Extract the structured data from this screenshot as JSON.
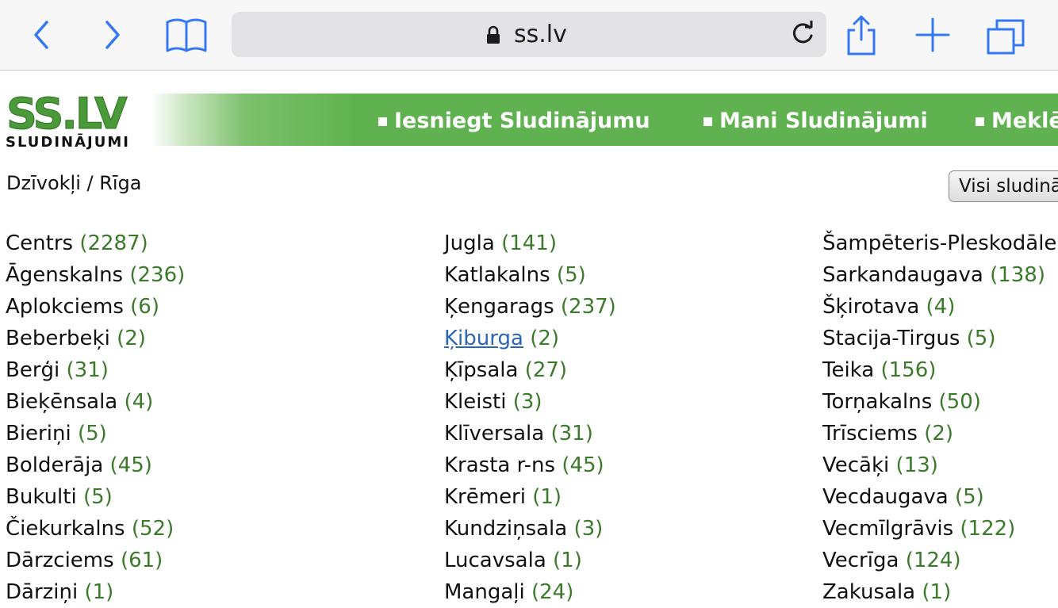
{
  "browser": {
    "url": "ss.lv",
    "colors": {
      "accent": "#3478f6"
    }
  },
  "header": {
    "logo": "SS.LV",
    "logo_sub": "SLUDINĀJUMI",
    "links": [
      "Iesniegt Sludinājumu",
      "Mani Sludinājumi",
      "Meklē"
    ]
  },
  "breadcrumb": "Dzīvokļi / Rīga",
  "visi_button": "Visi sludinā",
  "columns": [
    [
      {
        "name": "Centrs",
        "count": "(2287)"
      },
      {
        "name": "Āgenskalns",
        "count": "(236)"
      },
      {
        "name": "Aplokciems",
        "count": "(6)"
      },
      {
        "name": "Beberbeķi",
        "count": "(2)"
      },
      {
        "name": "Berģi",
        "count": "(31)"
      },
      {
        "name": "Bieķēnsala",
        "count": "(4)"
      },
      {
        "name": "Bieriņi",
        "count": "(5)"
      },
      {
        "name": "Bolderāja",
        "count": "(45)"
      },
      {
        "name": "Bukulti",
        "count": "(5)"
      },
      {
        "name": "Čiekurkalns",
        "count": "(52)"
      },
      {
        "name": "Dārzciems",
        "count": "(61)"
      },
      {
        "name": "Dārziņi",
        "count": "(1)"
      }
    ],
    [
      {
        "name": "Jugla",
        "count": "(141)"
      },
      {
        "name": "Katlakalns",
        "count": "(5)"
      },
      {
        "name": "Ķengarags",
        "count": "(237)"
      },
      {
        "name": "Ķiburga",
        "count": "(2)",
        "link": true
      },
      {
        "name": "Ķīpsala",
        "count": "(27)"
      },
      {
        "name": "Kleisti",
        "count": "(3)"
      },
      {
        "name": "Klīversala",
        "count": "(31)"
      },
      {
        "name": "Krasta r-ns",
        "count": "(45)"
      },
      {
        "name": "Krēmeri",
        "count": "(1)"
      },
      {
        "name": "Kundziņsala",
        "count": "(3)"
      },
      {
        "name": "Lucavsala",
        "count": "(1)"
      },
      {
        "name": "Mangaļi",
        "count": "(24)"
      }
    ],
    [
      {
        "name": "Šampēteris-Pleskodāle",
        "count": ""
      },
      {
        "name": "Sarkandaugava",
        "count": "(138)"
      },
      {
        "name": "Šķirotava",
        "count": "(4)"
      },
      {
        "name": "Stacija-Tirgus",
        "count": "(5)"
      },
      {
        "name": "Teika",
        "count": "(156)"
      },
      {
        "name": "Torņakalns",
        "count": "(50)"
      },
      {
        "name": "Trīsciems",
        "count": "(2)"
      },
      {
        "name": "Vecāķi",
        "count": "(13)"
      },
      {
        "name": "Vecdaugava",
        "count": "(5)"
      },
      {
        "name": "Vecmīlgrāvis",
        "count": "(122)"
      },
      {
        "name": "Vecrīga",
        "count": "(124)"
      },
      {
        "name": "Zakusala",
        "count": "(1)"
      }
    ]
  ]
}
